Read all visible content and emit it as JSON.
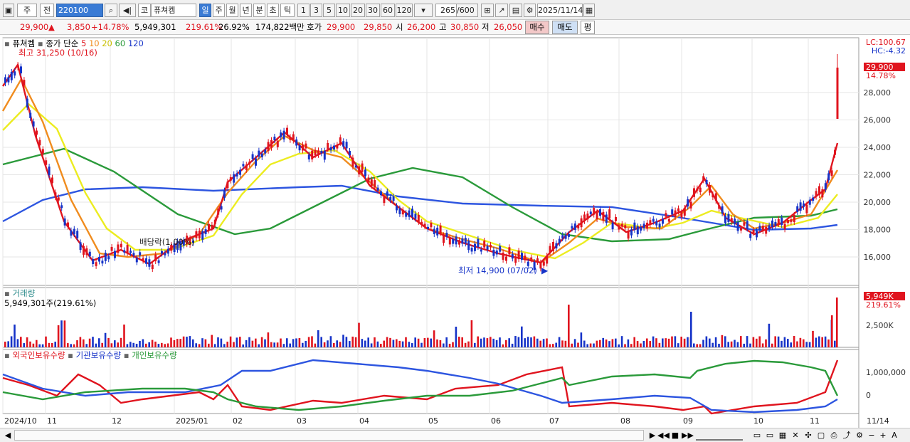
{
  "toolbar": {
    "market": "주",
    "type": "전",
    "code": "220100",
    "kind": "코",
    "name": "퓨쳐켐",
    "periods": [
      "일",
      "주",
      "월",
      "년",
      "분",
      "초",
      "틱"
    ],
    "intervals": [
      "1",
      "3",
      "5",
      "10",
      "20",
      "30",
      "60",
      "120"
    ],
    "count": "265",
    "count_total": "/600",
    "date": "2025/11/14"
  },
  "info": {
    "price": "29,900",
    "arrow": "▲",
    "change": "3,850",
    "change_pct": "+14.78%",
    "volume": "5,949,301",
    "vol_ratio": "219.61%",
    "turnover": "26.92%",
    "amount": "174,822백만",
    "ask_label": "호가",
    "ask": "29,900",
    "bid": "29,850",
    "open_label": "시",
    "open": "26,200",
    "high_label": "고",
    "high": "30,850",
    "low_label": "저",
    "low": "26,050",
    "sell": "매수",
    "buy": "매도",
    "avg": "평"
  },
  "price_panel": {
    "name": "퓨쳐켐",
    "ma_label": "종가 단순",
    "ma_periods": [
      "5",
      "10",
      "20",
      "60",
      "120"
    ],
    "ma_colors": [
      "#e0141e",
      "#f08c1e",
      "#ecec20",
      "#2a9a3a",
      "#2d55e0"
    ],
    "high_note": "최고 31,250 (10/16)",
    "low_note": "최저 14,900 (07/02)",
    "dividend": "배당락(1.00%)",
    "lc": "LC:100.67",
    "hc": "HC:-4.32",
    "last_price": "29,900",
    "last_pct": "14.78%",
    "y_ticks": [
      "28,000",
      "26,000",
      "24,000",
      "22,000",
      "20,000",
      "18,000",
      "16,000"
    ]
  },
  "volume_panel": {
    "title": "거래량",
    "value": "5,949,301주(219.61%)",
    "last": "5,949K",
    "last_pct": "219.61%",
    "tick": "2,500K"
  },
  "holding_panel": {
    "legend": [
      "외국인보유수량",
      "기관보유수량",
      "개인보유수량"
    ],
    "colors": [
      "#e0141e",
      "#2d55e0",
      "#2a9a3a"
    ],
    "ticks": [
      "1,000,000",
      "0"
    ]
  },
  "x_axis": [
    "2024/10",
    "11",
    "12",
    "2025/01",
    "02",
    "03",
    "04",
    "05",
    "06",
    "07",
    "08",
    "09",
    "10",
    "11"
  ],
  "x_right": "11/14"
}
